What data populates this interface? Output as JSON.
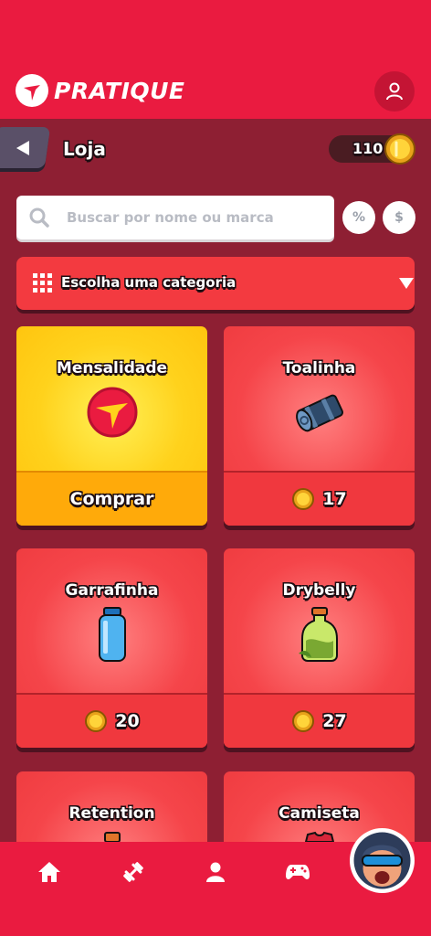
{
  "brand": {
    "name": "PRATIQUE",
    "logo_icon": "pratique-logo-icon"
  },
  "header": {
    "profile_icon": "user-icon"
  },
  "subheader": {
    "back_icon": "arrow-left-icon",
    "title": "Loja",
    "coins": "110"
  },
  "search": {
    "placeholder": "Buscar por nome ou marca",
    "percent_label": "%",
    "dollar_label": "$"
  },
  "category": {
    "label": "Escolha uma categoria",
    "icon": "grid-icon",
    "caret": "caret-down-icon"
  },
  "products": [
    {
      "name": "Mensalidade",
      "action": "Comprar",
      "icon": "pratique-emblem-icon"
    },
    {
      "name": "Toalinha",
      "price": "17",
      "icon": "towel-icon"
    },
    {
      "name": "Garrafinha",
      "price": "20",
      "icon": "bottle-icon"
    },
    {
      "name": "Drybelly",
      "price": "27",
      "icon": "herb-jar-icon"
    },
    {
      "name": "Retention",
      "icon": "jar-icon"
    },
    {
      "name": "Camiseta",
      "icon": "shirt-icon"
    }
  ],
  "nav": {
    "items": [
      "home-icon",
      "dumbbell-icon",
      "profile-icon",
      "gamepad-icon"
    ],
    "avatar": "avatar"
  },
  "colors": {
    "brand_red": "#ea1b40",
    "background": "#8e1f33",
    "card_red": "#f5454a",
    "gold": "#ffd21c"
  }
}
